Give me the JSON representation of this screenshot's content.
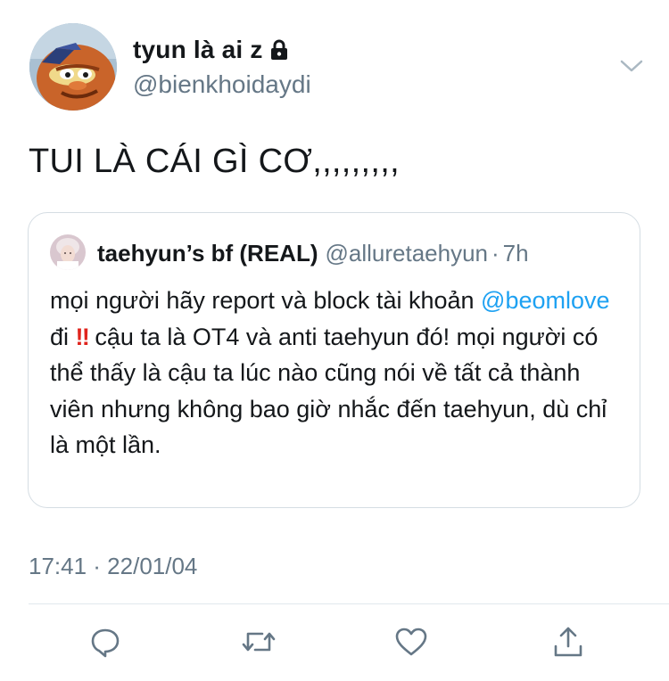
{
  "author": {
    "display_name": "tyun là ai z",
    "handle": "@bienkhoidaydi",
    "avatar_icon": "cartoon-avatar-icon",
    "protected_icon": "lock-icon"
  },
  "tweet": {
    "text": "TUI LÀ CÁI GÌ CƠ,,,,,,,,,",
    "timestamp": "17:41 · 22/01/04"
  },
  "quoted_tweet": {
    "display_name": "taehyun’s bf (REAL)",
    "handle": "@alluretaehyun",
    "separator": "·",
    "time": "7h",
    "body_part1": "mọi người hãy report và block tài khoản ",
    "mention": "@beomlove",
    "body_part2": " đi ",
    "emoji": "‼",
    "body_part3": " cậu ta là OT4 và anti taehyun đó! mọi người có thể thấy là cậu ta lúc nào cũng nói về tất cả thành viên nhưng không bao giờ nhắc đến taehyun, dù chỉ là một lần."
  },
  "actions": [
    {
      "icon": "reply-icon"
    },
    {
      "icon": "retweet-icon"
    },
    {
      "icon": "like-icon"
    },
    {
      "icon": "share-icon"
    }
  ],
  "colors": {
    "text": "#14171a",
    "secondary": "#657786",
    "link": "#1da1f2",
    "border": "#d5dde3",
    "emoji_red": "#e0241d"
  }
}
